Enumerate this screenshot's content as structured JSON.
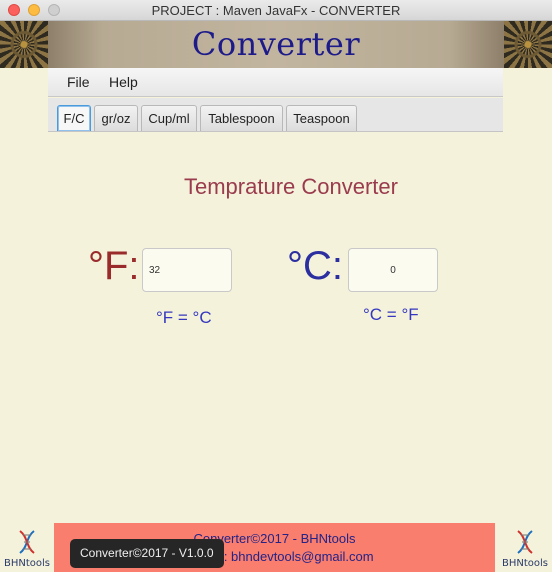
{
  "window": {
    "title": "PROJECT : Maven JavaFx - CONVERTER"
  },
  "header": {
    "title": "Converter"
  },
  "menu": {
    "items": [
      "File",
      "Help"
    ]
  },
  "tabs": [
    "F/C",
    "gr/oz",
    "Cup/ml",
    "Tablespoon",
    "Teaspoon"
  ],
  "active_tab": "F/C",
  "content": {
    "title": "Temprature Converter",
    "fahrenheit_label": "°F:",
    "celsius_label": "°C:",
    "fahrenheit_value": "32",
    "celsius_value": "0",
    "formula_f": "°F = °C",
    "formula_c": "°C = °F"
  },
  "footer": {
    "line1": "Converter©2017 - BHNtools",
    "line2": "Contact : bhndevtools@gmail.com",
    "logo_text": "BHNtools"
  },
  "tooltip": "Converter©2017 - V1.0.0",
  "colors": {
    "background": "#f4f2da",
    "title": "#1d1a8a",
    "section_title": "#9a3b4e",
    "fahrenheit": "#9a2b2b",
    "celsius": "#2b2fa0",
    "footer_bg": "#f97e6e"
  }
}
